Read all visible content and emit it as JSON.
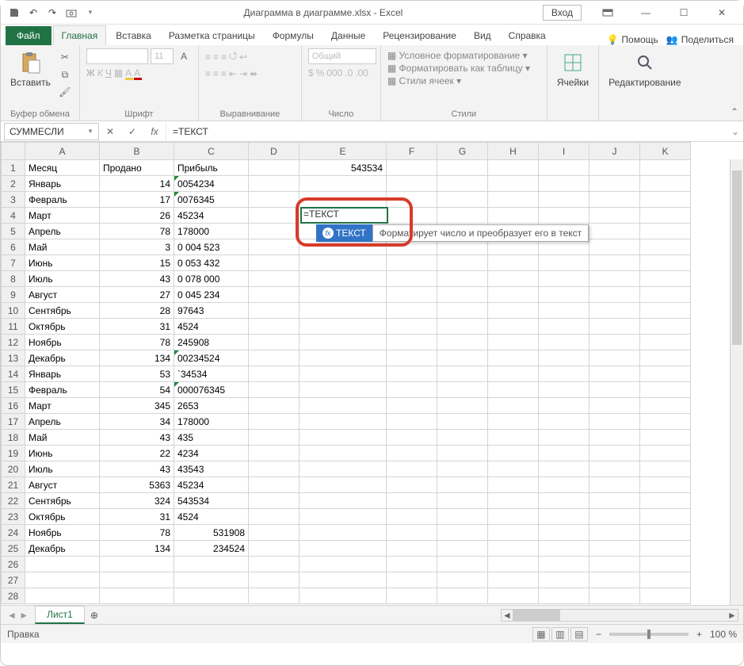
{
  "title": "Диаграмма в диаграмме.xlsx  -  Excel",
  "signin": "Вход",
  "tabs": {
    "file": "Файл",
    "home": "Главная",
    "insert": "Вставка",
    "layout": "Разметка страницы",
    "formulas": "Формулы",
    "data": "Данные",
    "review": "Рецензирование",
    "view": "Вид",
    "help": "Справка",
    "tell": "Помощь",
    "share": "Поделиться"
  },
  "groups": {
    "clipboard": "Буфер обмена",
    "font": "Шрифт",
    "align": "Выравнивание",
    "number": "Число",
    "styles": "Стили",
    "cells": "Ячейки",
    "editing": "Редактирование"
  },
  "bigbtns": {
    "paste": "Вставить",
    "cells": "Ячейки",
    "editing": "Редактирование"
  },
  "numberfmt": "Общий",
  "stylesItems": {
    "cond": "Условное форматирование",
    "table": "Форматировать как таблицу",
    "cell": "Стили ячеек"
  },
  "namebox": "СУММЕСЛИ",
  "formula": "=ТЕКСТ",
  "celledit": "=ТЕКСТ",
  "tipFn": "ТЕКСТ",
  "tipDesc": "Форматирует число и преобразует его в текст",
  "cols": [
    "A",
    "B",
    "C",
    "D",
    "E",
    "F",
    "G",
    "H",
    "I",
    "J",
    "K"
  ],
  "headers": {
    "A": "Месяц",
    "B": "Продано",
    "C": "Прибыль"
  },
  "e1": "543534",
  "rows": [
    {
      "n": 1,
      "a": "Месяц",
      "b": "Продано",
      "c": "Прибыль",
      "bl": true,
      "cl": true
    },
    {
      "n": 2,
      "a": "Январь",
      "b": "14",
      "c": "0054234",
      "gm": true
    },
    {
      "n": 3,
      "a": "Февраль",
      "b": "17",
      "c": "0076345",
      "gm": true
    },
    {
      "n": 4,
      "a": "Март",
      "b": "26",
      "c": "45234"
    },
    {
      "n": 5,
      "a": "Апрель",
      "b": "78",
      "c": "178000"
    },
    {
      "n": 6,
      "a": "Май",
      "b": "3",
      "c": "0 004 523"
    },
    {
      "n": 7,
      "a": "Июнь",
      "b": "15",
      "c": "0 053 432"
    },
    {
      "n": 8,
      "a": "Июль",
      "b": "43",
      "c": "0 078 000"
    },
    {
      "n": 9,
      "a": "Август",
      "b": "27",
      "c": "0 045 234"
    },
    {
      "n": 10,
      "a": "Сентябрь",
      "b": "28",
      "c": "97643"
    },
    {
      "n": 11,
      "a": "Октябрь",
      "b": "31",
      "c": "4524"
    },
    {
      "n": 12,
      "a": "Ноябрь",
      "b": "78",
      "c": "245908"
    },
    {
      "n": 13,
      "a": "Декабрь",
      "b": "134",
      "c": "00234524",
      "gm": true
    },
    {
      "n": 14,
      "a": "Январь",
      "b": "53",
      "c": "`34534"
    },
    {
      "n": 15,
      "a": "Февраль",
      "b": "54",
      "c": "000076345",
      "gm": true
    },
    {
      "n": 16,
      "a": "Март",
      "b": "345",
      "c": "2653"
    },
    {
      "n": 17,
      "a": "Апрель",
      "b": "34",
      "c": "178000"
    },
    {
      "n": 18,
      "a": "Май",
      "b": "43",
      "c": "435"
    },
    {
      "n": 19,
      "a": "Июнь",
      "b": "22",
      "c": "4234"
    },
    {
      "n": 20,
      "a": "Июль",
      "b": "43",
      "c": "43543"
    },
    {
      "n": 21,
      "a": "Август",
      "b": "5363",
      "c": "45234"
    },
    {
      "n": 22,
      "a": "Сентябрь",
      "b": "324",
      "c": "543534"
    },
    {
      "n": 23,
      "a": "Октябрь",
      "b": "31",
      "c": "4524"
    },
    {
      "n": 24,
      "a": "Ноябрь",
      "b": "78",
      "c": "531908",
      "cr": true
    },
    {
      "n": 25,
      "a": "Декабрь",
      "b": "134",
      "c": "234524",
      "cr": true
    }
  ],
  "sheettab": "Лист1",
  "status": "Правка",
  "zoom": "100 %"
}
